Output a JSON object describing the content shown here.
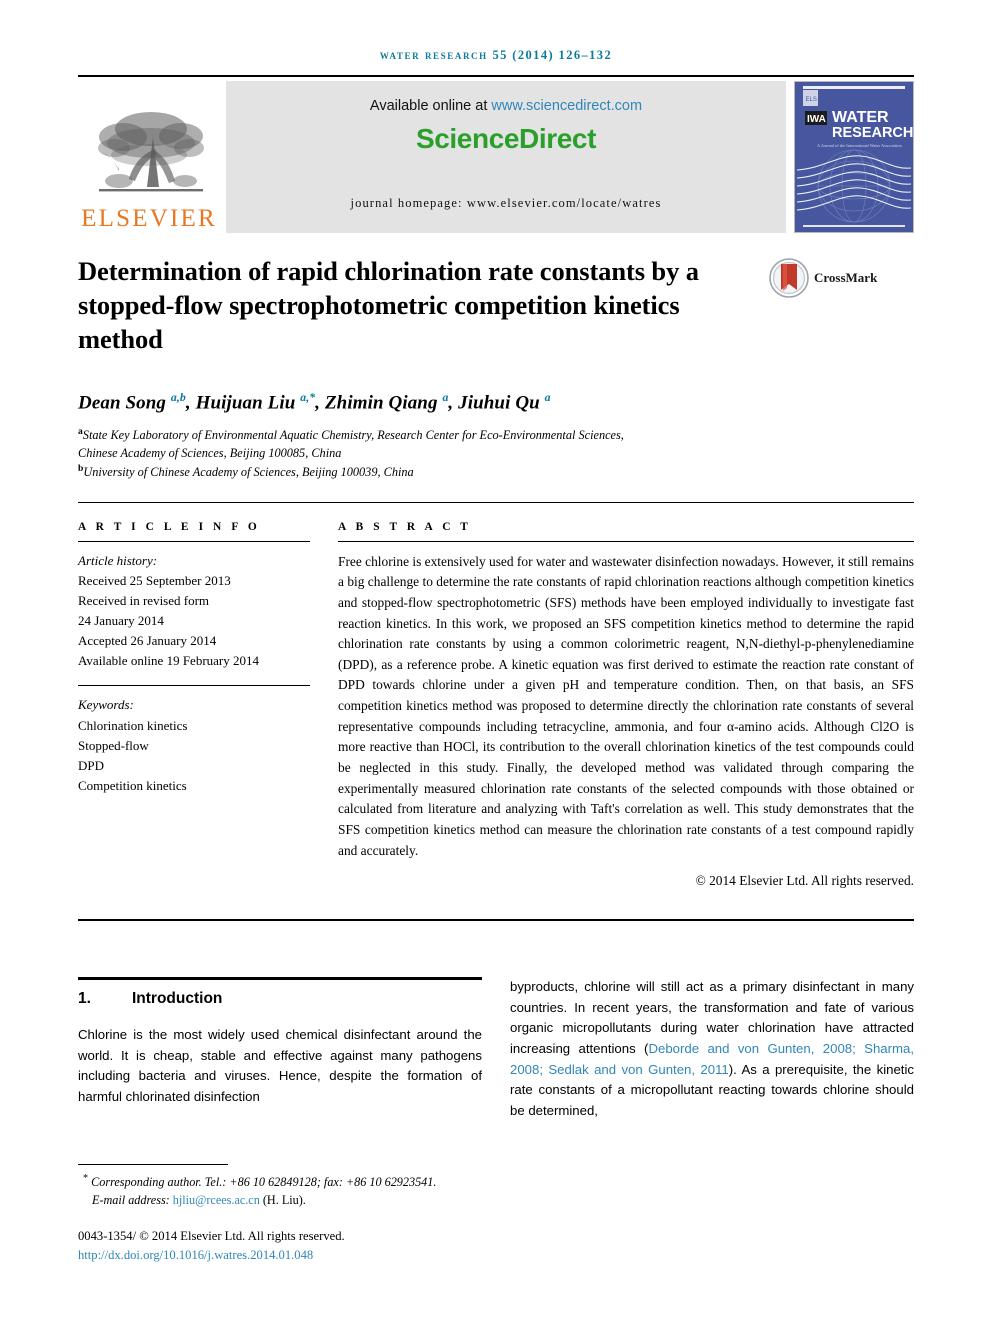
{
  "running_head": {
    "journal": "water research",
    "citation": "55 (2014) 126–132",
    "color": "#0b7a9e"
  },
  "masthead": {
    "publisher_logo_text": "ELSEVIER",
    "publisher_color": "#e87722",
    "available_text": "Available online at",
    "sciencedirect_url": "www.sciencedirect.com",
    "sciencedirect_logo": "ScienceDirect",
    "sciencedirect_color": "#2aa02a",
    "journal_homepage": "journal homepage: www.elsevier.com/locate/watres",
    "cover": {
      "title_line1": "WATER",
      "title_line2": "RESEARCH",
      "tagline": "A Journal of the International Water Association",
      "society_logo": "IWA",
      "background_color": "#4458a6"
    }
  },
  "article": {
    "title": "Determination of rapid chlorination rate constants by a stopped-flow spectrophotometric competition kinetics method",
    "crossmark_label": "CrossMark",
    "authors_html": "Dean Song <sup>a,b</sup>, Huijuan Liu <sup>a,*</sup>, Zhimin Qiang <sup>a</sup>, Jiuhui Qu <sup>a</sup>",
    "affiliations": [
      {
        "marker": "a",
        "line1": "State Key Laboratory of Environmental Aquatic Chemistry, Research Center for Eco-Environmental Sciences,",
        "line2": "Chinese Academy of Sciences, Beijing 100085, China"
      },
      {
        "marker": "b",
        "line1": "University of Chinese Academy of Sciences, Beijing 100039, China",
        "line2": ""
      }
    ]
  },
  "article_info": {
    "heading": "A R T I C L E   I N F O",
    "history_label": "Article history:",
    "history": [
      "Received 25 September 2013",
      "Received in revised form",
      "24 January 2014",
      "Accepted 26 January 2014",
      "Available online 19 February 2014"
    ],
    "keywords_label": "Keywords:",
    "keywords": [
      "Chlorination kinetics",
      "Stopped-flow",
      "DPD",
      "Competition kinetics"
    ]
  },
  "abstract": {
    "heading": "A B S T R A C T",
    "text": "Free chlorine is extensively used for water and wastewater disinfection nowadays. However, it still remains a big challenge to determine the rate constants of rapid chlorination reactions although competition kinetics and stopped-flow spectrophotometric (SFS) methods have been employed individually to investigate fast reaction kinetics. In this work, we proposed an SFS competition kinetics method to determine the rapid chlorination rate constants by using a common colorimetric reagent, N,N-diethyl-p-phenylenediamine (DPD), as a reference probe. A kinetic equation was first derived to estimate the reaction rate constant of DPD towards chlorine under a given pH and temperature condition. Then, on that basis, an SFS competition kinetics method was proposed to determine directly the chlorination rate constants of several representative compounds including tetracycline, ammonia, and four α-amino acids. Although Cl2O is more reactive than HOCl, its contribution to the overall chlorination kinetics of the test compounds could be neglected in this study. Finally, the developed method was validated through comparing the experimentally measured chlorination rate constants of the selected compounds with those obtained or calculated from literature and analyzing with Taft's correlation as well. This study demonstrates that the SFS competition kinetics method can measure the chlorination rate constants of a test compound rapidly and accurately.",
    "copyright": "© 2014 Elsevier Ltd. All rights reserved."
  },
  "introduction": {
    "number": "1.",
    "heading": "Introduction",
    "left_paragraph": "Chlorine is the most widely used chemical disinfectant around the world. It is cheap, stable and effective against many pathogens including bacteria and viruses. Hence, despite the formation of harmful chlorinated disinfection",
    "right_before_cite": "byproducts, chlorine will still act as a primary disinfectant in many countries. In recent years, the transformation and fate of various organic micropollutants during water chlorination have attracted increasing attentions (",
    "citation": "Deborde and von Gunten, 2008; Sharma, 2008; Sedlak and von Gunten, 2011",
    "right_after_cite": "). As a prerequisite, the kinetic rate constants of a micropollutant reacting towards chlorine should be determined,"
  },
  "footnotes": {
    "corresponding_marker": "*",
    "corresponding_text": "Corresponding author. Tel.: +86 10 62849128; fax: +86 10 62923541.",
    "corresponding_italic": "Corresponding author",
    "email_label": "E-mail address:",
    "email": "hjliu@rcees.ac.cn",
    "email_suffix": "(H. Liu).",
    "issn_line": "0043-1354/ © 2014 Elsevier Ltd. All rights reserved.",
    "doi_url": "http://dx.doi.org/10.1016/j.watres.2014.01.048",
    "link_color": "#2f87b7"
  }
}
